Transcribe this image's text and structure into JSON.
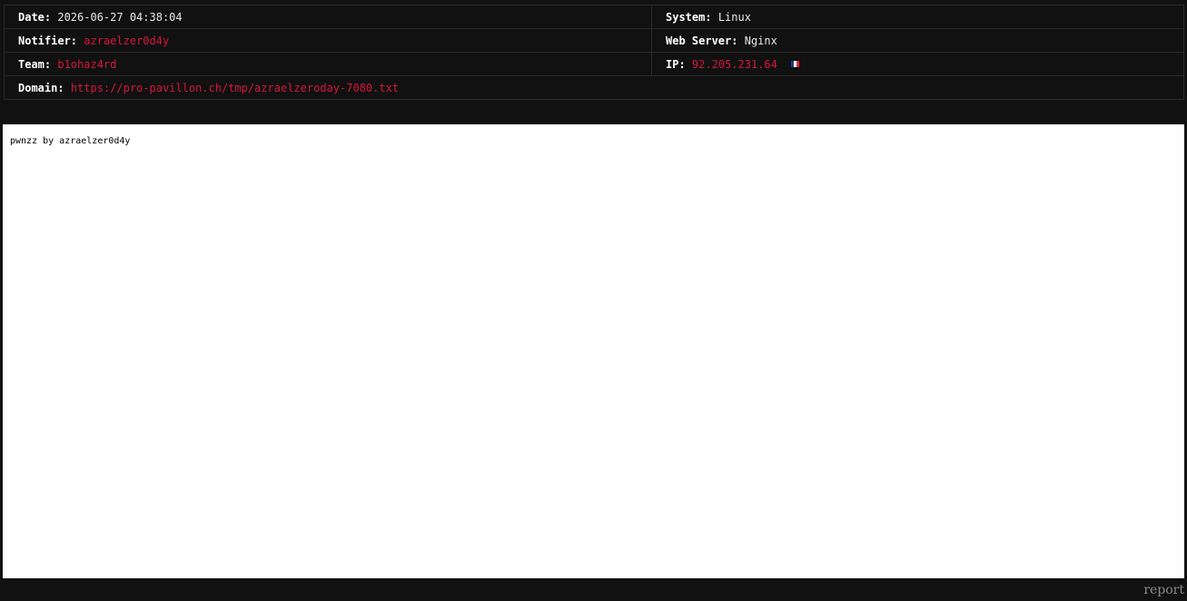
{
  "info": {
    "date_label": "Date:",
    "date_value": "2026-06-27 04:38:04",
    "system_label": "System:",
    "system_value": "Linux",
    "notifier_label": "Notifier:",
    "notifier_value": "azraelzer0d4y",
    "webserver_label": "Web Server:",
    "webserver_value": "Nginx",
    "team_label": "Team:",
    "team_value": "b1ohaz4rd",
    "ip_label": "IP:",
    "ip_value": "92.205.231.64",
    "ip_flag_icon": "france-flag-icon",
    "domain_label": "Domain:",
    "domain_value": "https://pro-pavillon.ch/tmp/azraelzeroday-7080.txt"
  },
  "content": {
    "text": "pwnzz by azraelzer0d4y"
  },
  "footer": {
    "report_label": "report"
  },
  "colors": {
    "background": "#111111",
    "accent_red": "#d4173a",
    "border": "#2a2a2a"
  }
}
